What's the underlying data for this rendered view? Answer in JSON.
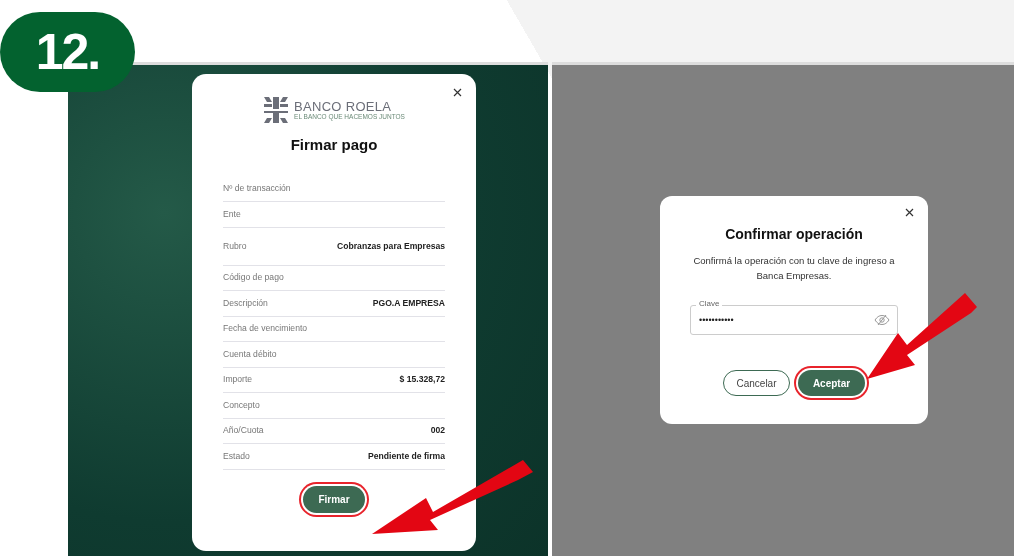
{
  "step_badge": "12.",
  "sign_dialog": {
    "logo": {
      "name": "BANCO ROELA",
      "tagline": "EL BANCO QUE HACEMOS JUNTOS"
    },
    "title": "Firmar pago",
    "rows": [
      {
        "label": "Nº de transacción"
      },
      {
        "label": "Ente"
      },
      {
        "label": "Rubro",
        "value": "Cobranzas para Empresas"
      },
      {
        "label": "Código de pago"
      },
      {
        "label": "Descripción",
        "value": "PGO.A EMPRESA"
      },
      {
        "label": "Fecha de vencimiento"
      },
      {
        "label": "Cuenta débito"
      },
      {
        "label": "Importe",
        "value": "$ 15.328,72"
      },
      {
        "label": "Concepto"
      },
      {
        "label": "Año/Cuota",
        "value": "002"
      },
      {
        "label": "Estado",
        "value": "Pendiente de firma"
      }
    ],
    "button": {
      "label": "Firmar",
      "highlighted": true
    }
  },
  "confirm_dialog": {
    "title": "Confirmar operación",
    "message": "Confirmá la operación con tu clave de ingreso a Banca Empresas.",
    "field": {
      "label": "Clave",
      "value": "•••••••••••"
    },
    "buttons": [
      {
        "label": "Cancelar",
        "kind": "secondary",
        "highlighted": false
      },
      {
        "label": "Aceptar",
        "kind": "primary",
        "highlighted": true
      }
    ]
  }
}
